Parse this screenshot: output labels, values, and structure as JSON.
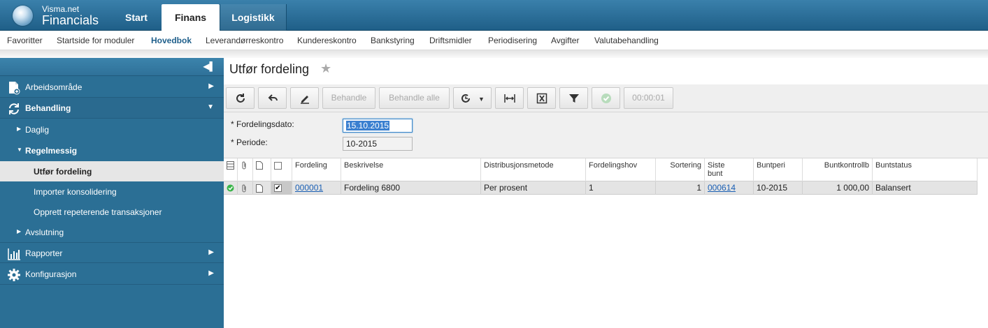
{
  "brand": {
    "line1": "Visma.net",
    "line2": "Financials"
  },
  "top_tabs": [
    {
      "label": "Start"
    },
    {
      "label": "Finans",
      "active": true
    },
    {
      "label": "Logistikk"
    }
  ],
  "subnav": [
    {
      "label": "Favoritter"
    },
    {
      "label": "Startside for moduler"
    },
    {
      "label": "Hovedbok",
      "active": true
    },
    {
      "label": "Leverandørreskontro"
    },
    {
      "label": "Kundereskontro"
    },
    {
      "label": "Bankstyring"
    },
    {
      "label": "Driftsmidler"
    },
    {
      "label": "Periodisering"
    },
    {
      "label": "Avgifter"
    },
    {
      "label": "Valutabehandling"
    }
  ],
  "sidebar": {
    "collapse_icon": "collapse-left-icon",
    "sections": [
      {
        "label": "Arbeidsområde",
        "icon": "document-add-icon"
      },
      {
        "label": "Behandling",
        "icon": "refresh-icon"
      },
      {
        "label": "Rapporter",
        "icon": "bar-chart-icon"
      },
      {
        "label": "Konfigurasjon",
        "icon": "gear-icon"
      }
    ],
    "groups": [
      {
        "label": "Daglig"
      },
      {
        "label": "Regelmessig"
      },
      {
        "label": "Avslutning"
      }
    ],
    "items": [
      {
        "label": "Utfør fordeling",
        "selected": true
      },
      {
        "label": "Importer konsolidering"
      },
      {
        "label": "Opprett repeterende transaksjoner"
      }
    ]
  },
  "page": {
    "title": "Utfør fordeling"
  },
  "toolbar": {
    "process_label": "Behandle",
    "process_all_label": "Behandle alle",
    "timer": "00:00:01"
  },
  "form": {
    "date_label": "Fordelingsdato:",
    "date_value": "15.10.2015",
    "period_label": "Periode:",
    "period_value": "10-2015",
    "required_mark": "*"
  },
  "grid": {
    "headers": {
      "fordeling": "Fordeling",
      "beskrivelse": "Beskrivelse",
      "distribusjonsmetode": "Distribusjonsmetode",
      "fordelingshov": "Fordelingshov",
      "sortering": "Sortering",
      "siste_bunt_1": "Siste",
      "siste_bunt_2": "bunt",
      "buntperiode": "Buntperi",
      "buntkontroll": "Buntkontrollb",
      "buntstatus": "Buntstatus"
    },
    "rows": [
      {
        "fordeling": "000001",
        "beskrivelse": "Fordeling 6800",
        "distribusjonsmetode": "Per prosent",
        "fordelingshov": "1",
        "sortering": "1",
        "siste_bunt": "000614",
        "buntperiode": "10-2015",
        "buntkontroll": "1 000,00",
        "buntstatus": "Balansert",
        "checked": true
      }
    ]
  },
  "colors": {
    "accent": "#2b6f95",
    "link": "#1a5fb4",
    "ok": "#3bb54a"
  }
}
